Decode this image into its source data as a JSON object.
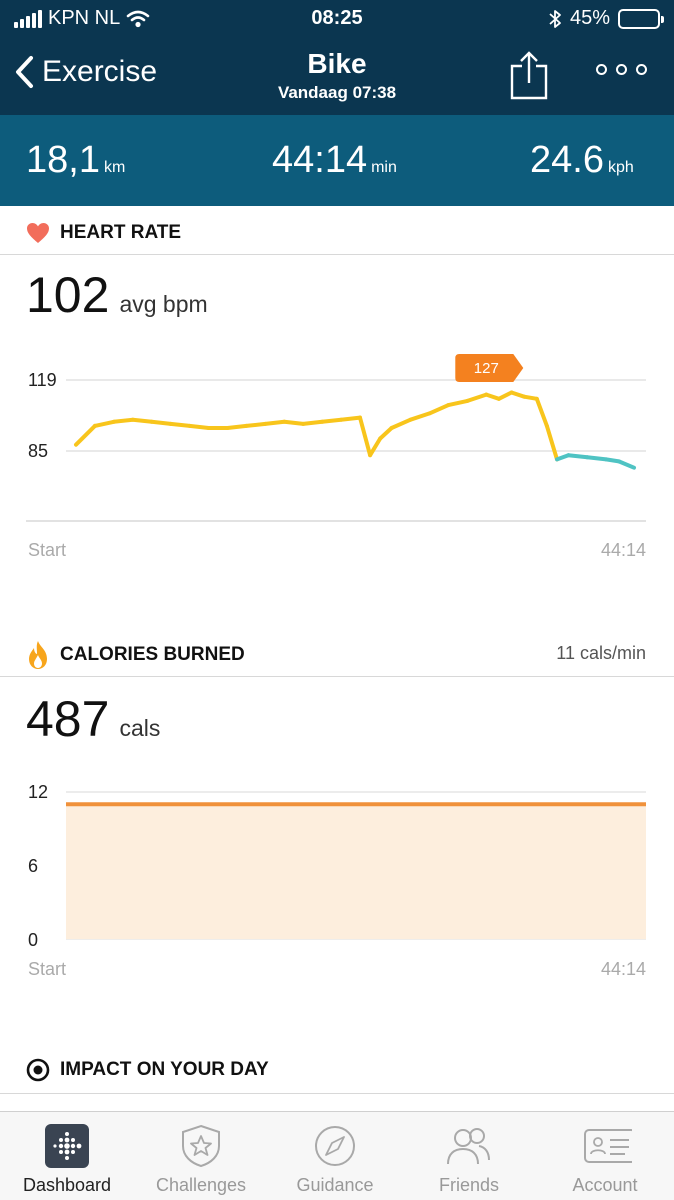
{
  "status_bar": {
    "carrier": "KPN NL",
    "time": "08:25",
    "battery": "45%"
  },
  "nav": {
    "back_label": "Exercise",
    "title": "Bike",
    "subtitle": "Vandaag 07:38"
  },
  "summary": [
    {
      "value": "18,1",
      "unit": "km"
    },
    {
      "value": "44:14",
      "unit": "min"
    },
    {
      "value": "24.6",
      "unit": "kph"
    }
  ],
  "heart_rate": {
    "title": "HEART RATE",
    "avg_value": "102",
    "avg_unit": "avg bpm",
    "y_labels": [
      "119",
      "85"
    ],
    "peak_badge": "127",
    "x_start": "Start",
    "x_end": "44:14",
    "colors": {
      "fat_burn": "#f8c51c",
      "out_of_zone": "#4fc3c3",
      "badge": "#f4811f",
      "heart": "#f26d5b"
    }
  },
  "calories": {
    "title": "CALORIES BURNED",
    "rate": "11 cals/min",
    "total_value": "487",
    "total_unit": "cals",
    "y_labels": [
      "12",
      "6",
      "0"
    ],
    "x_start": "Start",
    "x_end": "44:14",
    "colors": {
      "line": "#f0913a",
      "fill": "#fdeedd"
    }
  },
  "impact": {
    "title": "IMPACT ON YOUR DAY"
  },
  "tabs": [
    {
      "label": "Dashboard",
      "icon": "dashboard-icon",
      "active": true
    },
    {
      "label": "Challenges",
      "icon": "star-badge-icon",
      "active": false
    },
    {
      "label": "Guidance",
      "icon": "compass-icon",
      "active": false
    },
    {
      "label": "Friends",
      "icon": "friends-icon",
      "active": false
    },
    {
      "label": "Account",
      "icon": "id-card-icon",
      "active": false
    }
  ],
  "chart_data": [
    {
      "type": "line",
      "title": "HEART RATE",
      "xlabel": "",
      "ylabel": "",
      "x_ticks": [
        "Start",
        "44:14"
      ],
      "y_ticks": [
        85,
        119
      ],
      "ylim": [
        60,
        130
      ],
      "grid": true,
      "x_minutes": [
        0,
        1.5,
        3,
        4.5,
        6,
        7.5,
        9,
        10.5,
        12,
        13.5,
        15,
        16.5,
        18,
        19.5,
        21,
        22.5,
        23.3,
        24.1,
        25,
        26.5,
        28,
        29.5,
        31,
        32.5,
        33.5,
        34.5,
        35.5,
        36.5,
        37.3,
        38.1,
        39,
        40.5,
        42,
        43,
        44.2
      ],
      "series": [
        {
          "values": [
            88,
            97,
            99,
            100,
            99,
            98,
            97,
            96,
            96,
            97,
            98,
            99,
            98,
            99,
            100,
            101,
            83,
            91,
            96,
            100,
            103,
            107,
            109,
            112,
            110,
            113,
            111,
            110,
            97,
            81,
            83,
            82,
            81,
            80,
            77
          ]
        }
      ],
      "annotations": [
        {
          "label": "127",
          "x_minutes": 32.5
        }
      ]
    },
    {
      "type": "area",
      "title": "CALORIES BURNED",
      "xlabel": "",
      "ylabel": "",
      "x_ticks": [
        "Start",
        "44:14"
      ],
      "y_ticks": [
        0,
        6,
        12
      ],
      "ylim": [
        0,
        12
      ],
      "grid": true,
      "x_minutes": [
        0,
        44.2
      ],
      "series": [
        {
          "values": [
            11,
            11
          ]
        }
      ]
    }
  ]
}
